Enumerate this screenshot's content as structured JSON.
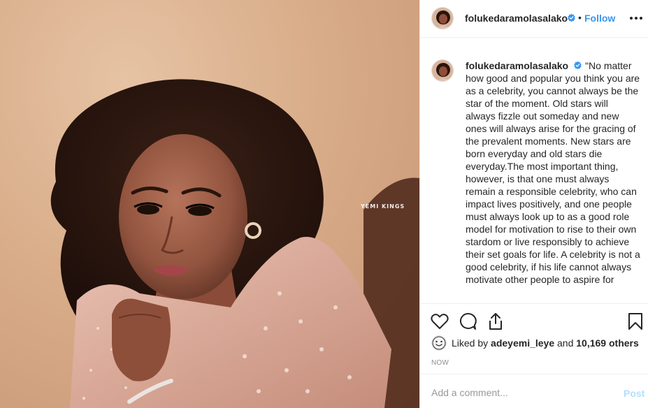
{
  "post": {
    "username": "folukedaramolasalako",
    "verified": true,
    "follow_label": "Follow",
    "separator": "•",
    "photo_watermark": "YEMI KINGS",
    "caption": "\"No matter how good and popular you think you are as a celebrity, you cannot always be the star of the moment. Old stars will always fizzle out someday and new ones will always arise for the gracing of the prevalent moments. New stars are born everyday and old stars die everyday.The most important thing, however, is that one must always remain a responsible celebrity, who can impact lives positively, and one people must always look up to as a good role model for motivation to rise to their own stardom or live responsibly to achieve their set goals for life. A celebrity is not a good celebrity, if his life cannot always motivate other people to aspire for",
    "likes": {
      "prefix": "Liked by",
      "liker": "adeyemi_leye",
      "joiner": "and",
      "others": "10,169 others"
    },
    "timestamp": "NOW",
    "comment_placeholder": "Add a comment...",
    "post_label": "Post"
  },
  "icons": {
    "more": "more-options-icon",
    "like": "heart-icon",
    "comment": "comment-icon",
    "share": "share-icon",
    "save": "bookmark-icon",
    "verified": "verified-badge-icon"
  },
  "colors": {
    "link_blue": "#3897f0",
    "verified_blue": "#3897f0",
    "post_disabled": "#b2dffc",
    "muted": "#8e8e8e",
    "border": "#efefef"
  }
}
